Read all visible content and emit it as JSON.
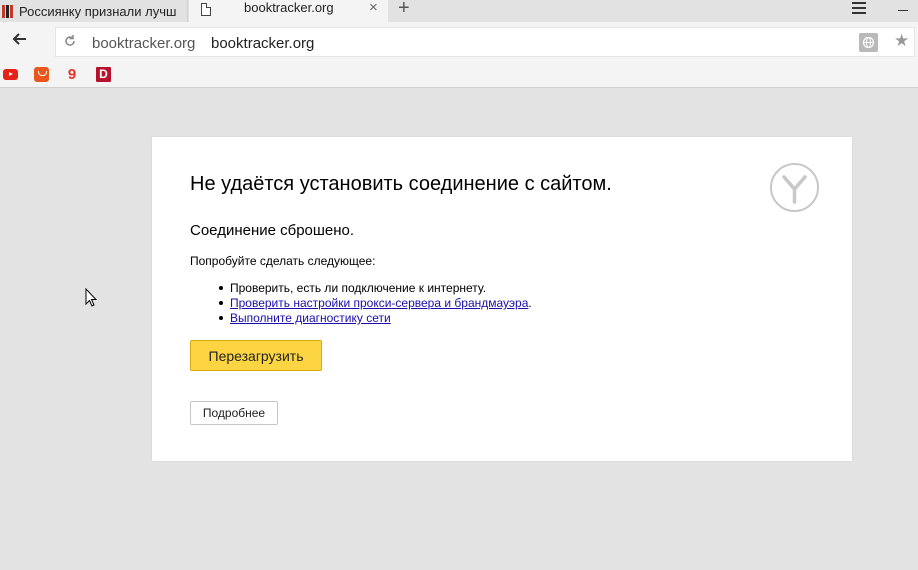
{
  "tabs": [
    {
      "label": "Россиянку признали лучш",
      "icon": "news-favicon",
      "active": false
    },
    {
      "label": "booktracker.org",
      "icon": "document-icon",
      "active": true
    }
  ],
  "tab_close": "×",
  "new_tab": "+",
  "address": {
    "host": "booktracker.org",
    "page_title": "booktracker.org"
  },
  "bookmarks": [
    {
      "name": "youtube-icon"
    },
    {
      "name": "aliexpress-icon"
    },
    {
      "name": "maps-icon",
      "glyph": "9"
    },
    {
      "name": "d-icon",
      "glyph": "D"
    }
  ],
  "error": {
    "heading": "Не удаётся установить соединение с сайтом.",
    "subheading": "Соединение сброшено.",
    "suggest": "Попробуйте сделать следующее:",
    "items": [
      {
        "text": "Проверить, есть ли подключение к интернету.",
        "link": false
      },
      {
        "text": "Проверить настройки прокси-сервера и брандмауэра",
        "link": true,
        "suffix": "."
      },
      {
        "text": "Выполните диагностику сети",
        "link": true,
        "suffix": ""
      }
    ],
    "reload_label": "Перезагрузить",
    "details_label": "Подробнее"
  },
  "colors": {
    "accent_button": "#fdd543",
    "link": "#1a0dab",
    "page_bg": "#e3e3e3"
  }
}
